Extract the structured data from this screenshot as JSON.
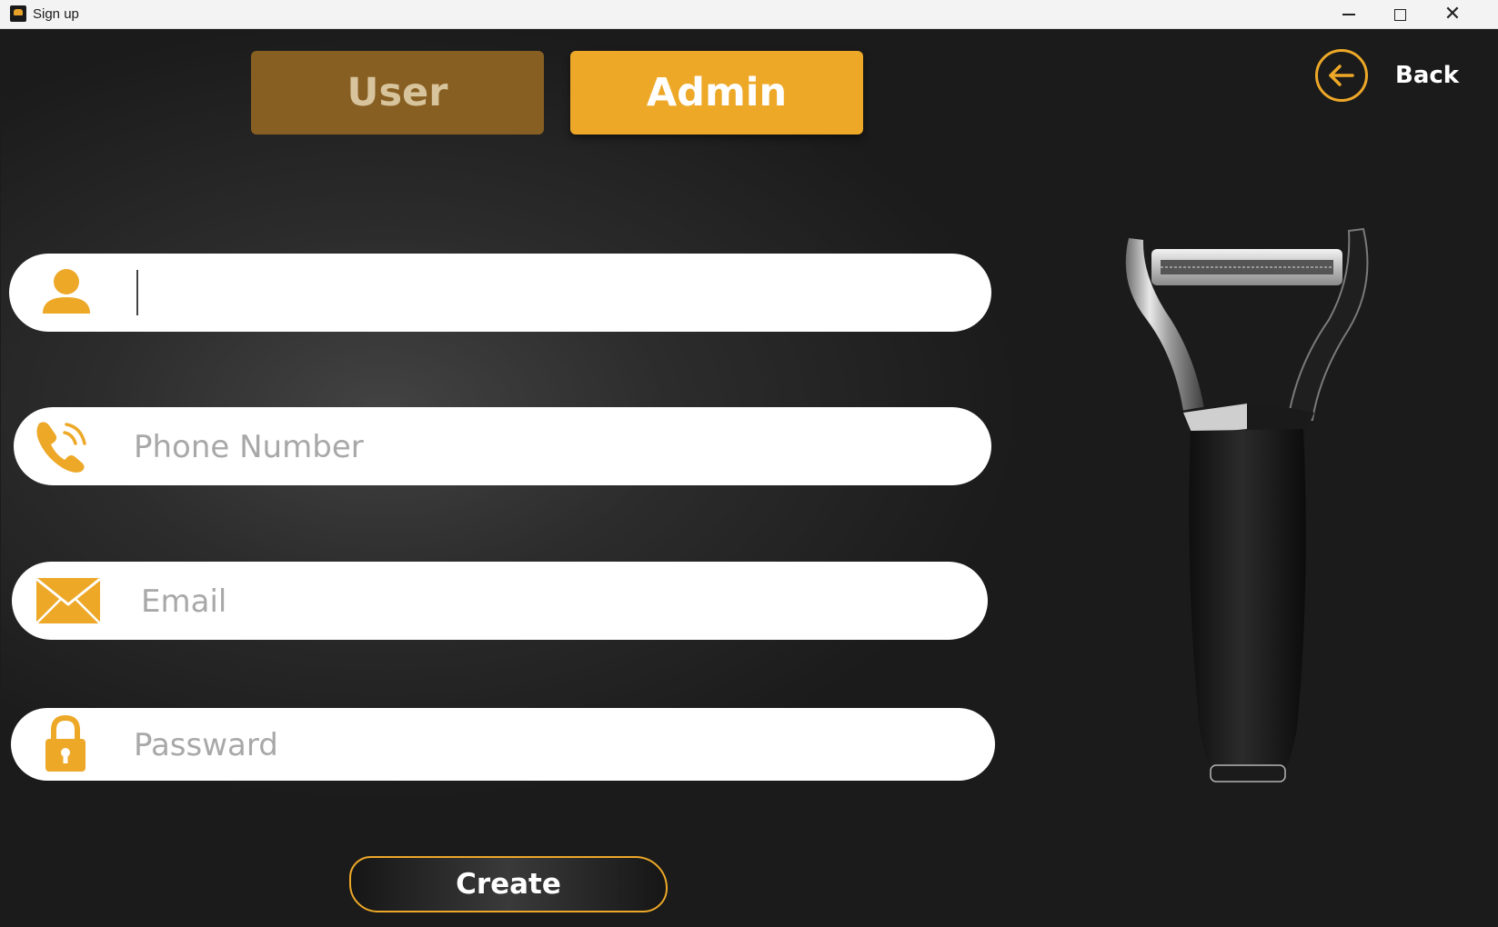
{
  "window": {
    "title": "Sign up"
  },
  "tabs": {
    "user_label": "User",
    "admin_label": "Admin",
    "active": "Admin"
  },
  "back": {
    "label": "Back"
  },
  "form": {
    "name": {
      "value": "",
      "placeholder": ""
    },
    "phone": {
      "value": "",
      "placeholder": "Phone Number"
    },
    "email": {
      "value": "",
      "placeholder": "Email"
    },
    "password": {
      "value": "",
      "placeholder": "Passward"
    }
  },
  "create_button": {
    "label": "Create"
  },
  "colors": {
    "accent": "#eda828",
    "tab_inactive": "#875f22",
    "background": "#1c1c1c",
    "field": "#ffffff"
  },
  "icons": {
    "name": "user-icon",
    "phone": "phone-icon",
    "email": "envelope-icon",
    "password": "lock-icon",
    "back": "arrow-left-icon"
  }
}
